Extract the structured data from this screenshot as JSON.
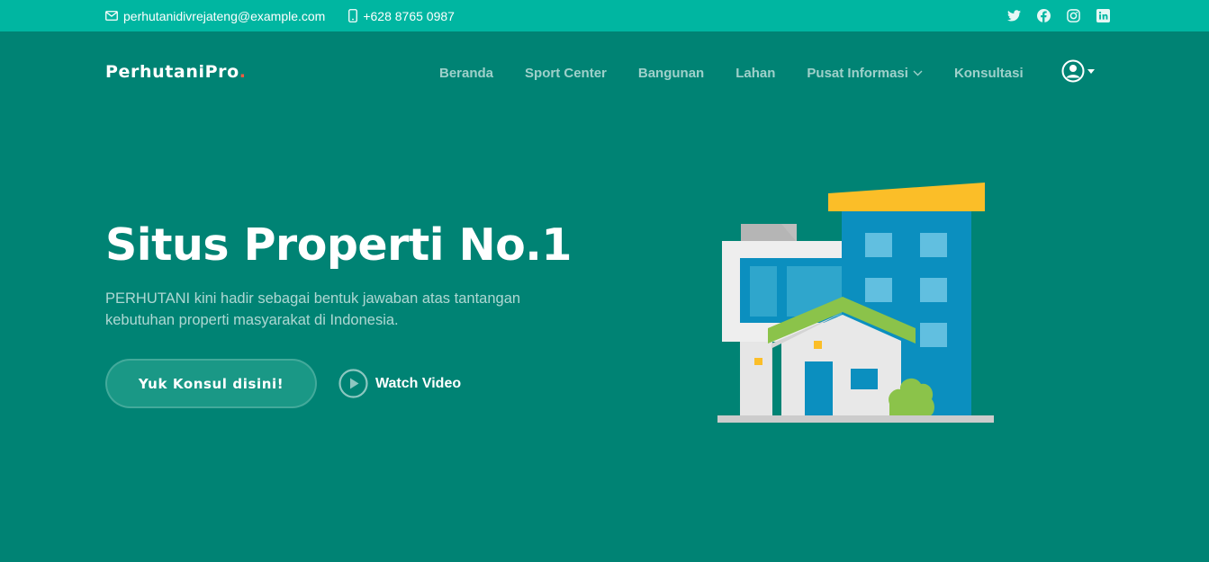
{
  "topbar": {
    "email": "perhutanidivrejateng@example.com",
    "phone": "+628 8765 0987",
    "social": [
      "twitter-icon",
      "facebook-icon",
      "instagram-icon",
      "linkedin-icon"
    ]
  },
  "header": {
    "logo_text": "PerhutaniPro",
    "logo_dot": ".",
    "nav": [
      {
        "label": "Beranda"
      },
      {
        "label": "Sport Center"
      },
      {
        "label": "Bangunan"
      },
      {
        "label": "Lahan"
      },
      {
        "label": "Pusat Informasi"
      },
      {
        "label": "Konsultasi"
      }
    ]
  },
  "hero": {
    "title": "Situs Properti No.1",
    "description": "PERHUTANI kini hadir sebagai bentuk jawaban atas tantangan kebutuhan properti masyarakat di Indonesia.",
    "cta_label": "Yuk Konsul disini!",
    "video_label": "Watch Video"
  },
  "colors": {
    "background": "#008374",
    "topbar": "#00b6a1",
    "accent_dot": "#f85a40",
    "building_blue": "#0b8fbf",
    "roof_yellow": "#fbbe28",
    "roof_green": "#8bc34a"
  }
}
